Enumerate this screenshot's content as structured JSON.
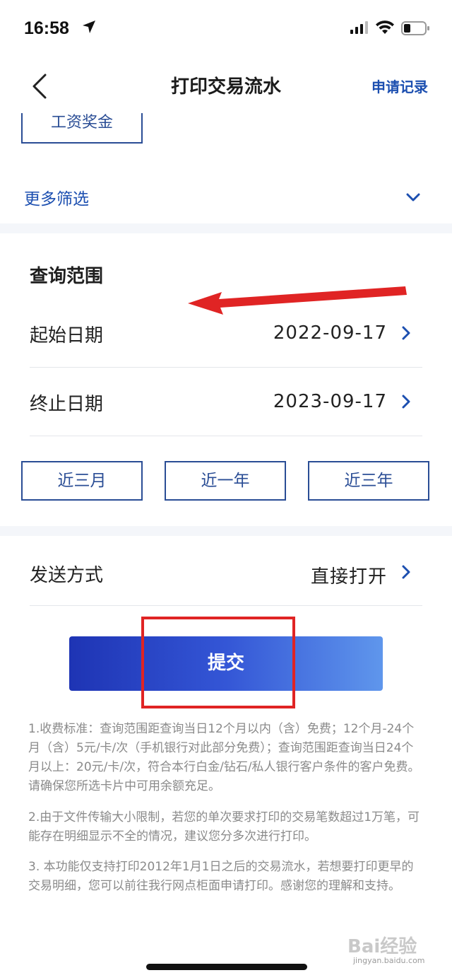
{
  "status_bar": {
    "time": "16:58"
  },
  "header": {
    "title": "打印交易流水",
    "record_link": "申请记录"
  },
  "filter": {
    "tag_partial": "工资奖金",
    "more_filter": "更多筛选"
  },
  "query_range": {
    "title": "查询范围",
    "start_label": "起始日期",
    "start_value": "2022-09-17",
    "end_label": "终止日期",
    "end_value": "2023-09-17",
    "quick_options": [
      "近三月",
      "近一年",
      "近三年"
    ]
  },
  "send": {
    "label": "发送方式",
    "value": "直接打开"
  },
  "submit_label": "提交",
  "notes": [
    "1.收费标准：查询范围距查询当日12个月以内（含）免费；12个月-24个月（含）5元/卡/次（手机银行对此部分免费）；查询范围距查询当日24个月以上：20元/卡/次，符合本行白金/钻石/私人银行客户条件的客户免费。请确保您所选卡片中可用余额充足。",
    "2.由于文件传输大小限制，若您的单次要求打印的交易笔数超过1万笔，可能存在明细显示不全的情况，建议您分多次进行打印。",
    "3. 本功能仅支持打印2012年1月1日之后的交易流水，若想要打印更早的交易明细，您可以前往我行网点柜面申请打印。感谢您的理解和支持。"
  ],
  "watermark": {
    "logo": "Bai经验",
    "url": "jingyan.baidu.com"
  }
}
